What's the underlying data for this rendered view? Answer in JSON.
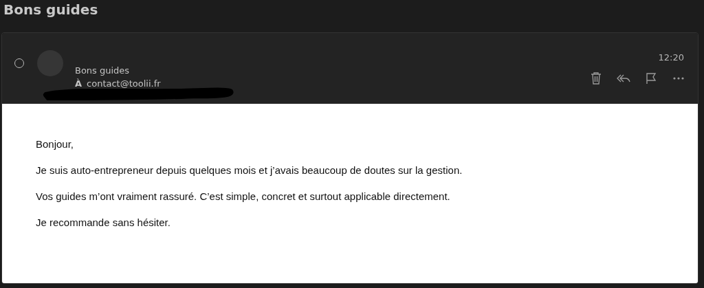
{
  "page_title": "Bons guides",
  "message": {
    "selected": false,
    "subject": "Bons guides",
    "to_label": "À",
    "to_address": "contact@toolii.fr",
    "time": "12:20",
    "body": [
      "Bonjour,",
      "Je suis auto-entrepreneur depuis quelques mois et j’avais beaucoup de doutes sur la gestion.",
      "Vos guides m’ont vraiment rassuré. C’est simple, concret et surtout applicable directement.",
      "Je recommande sans hésiter."
    ]
  }
}
